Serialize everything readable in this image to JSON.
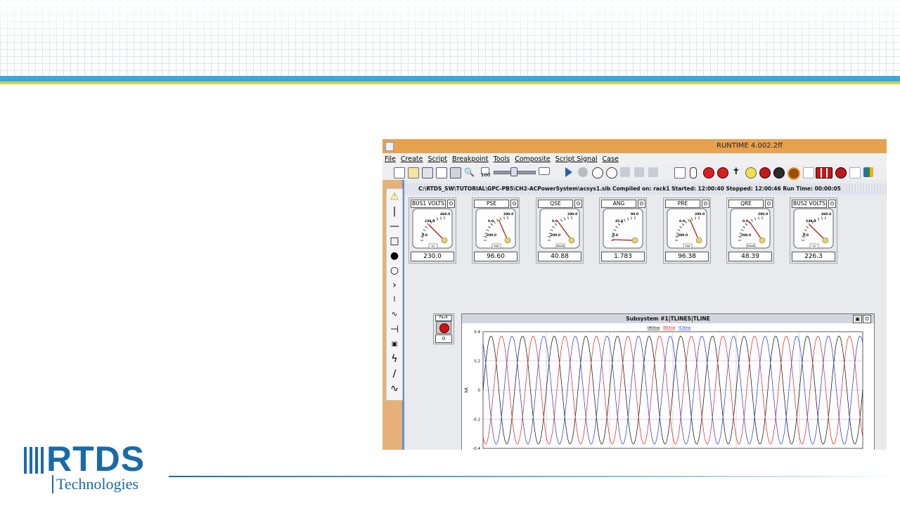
{
  "app": {
    "window_title": "RUNTIME 4.002.2ff",
    "menu": [
      "File",
      "Create",
      "Script",
      "Breakpoint",
      "Tools",
      "Composite",
      "Script Signal",
      "Case"
    ],
    "zoom_value": "100",
    "path_info": "C:\\RTDS_SW\\TUTORIAL\\GPC-PB5\\CH2-ACPowerSystem\\acsys1.sib   Compiled on: rack1   Started: 12:00:40  Stopped: 12:00:46  Run Time: 00:00:05"
  },
  "meters": [
    {
      "label": "BUS1 VOLTS",
      "unit": "kV",
      "scale": [
        "0.0",
        "230.0",
        "460.0"
      ],
      "value": "230.0",
      "frac": 0.5
    },
    {
      "label": "PSE",
      "unit": "MW",
      "scale": [
        "-200.0",
        "0.0",
        "200.0"
      ],
      "value": "96.60",
      "frac": 0.74
    },
    {
      "label": "QSE",
      "unit": "MVAR",
      "scale": [
        "-200.0",
        "0.0",
        "200.0"
      ],
      "value": "40.88",
      "frac": 0.6
    },
    {
      "label": "ANG",
      "unit": "",
      "scale": [
        "0.0",
        "45.0",
        "90.0"
      ],
      "value": "1.783",
      "frac": 0.02
    },
    {
      "label": "PRE",
      "unit": "MW",
      "scale": [
        "-200.0",
        "0.0",
        "200.0"
      ],
      "value": "96.38",
      "frac": 0.74
    },
    {
      "label": "QRE",
      "unit": "MVAR",
      "scale": [
        "-200.0",
        "0.0",
        "200.0"
      ],
      "value": "48.39",
      "frac": 0.62
    },
    {
      "label": "BUS2 VOLTS",
      "unit": "kV",
      "scale": [
        "0.0",
        "230.0",
        "460.0"
      ],
      "value": "226.3",
      "frac": 0.49
    }
  ],
  "fault": {
    "label": "Fault",
    "value": "0"
  },
  "plot": {
    "title": "Subsystem #1|TLINES|TLINE",
    "legend": [
      "IAtline",
      "IBtline",
      "ICtline"
    ]
  },
  "chart_data": {
    "type": "line",
    "title": "Subsystem #1|TLINES|TLINE",
    "xlabel": "",
    "ylabel": "kA",
    "xlim": [
      0,
      0.2
    ],
    "ylim": [
      -0.4,
      0.4
    ],
    "xticks": [
      "0",
      "0.03333",
      "0.06667",
      "0.1",
      "0.13333",
      "0.16667",
      "0.2"
    ],
    "yticks": [
      "0.4",
      "0.2",
      "0",
      "-0.2",
      "-0.4"
    ],
    "frequency_hz": 60,
    "amplitude": 0.37,
    "series": [
      {
        "name": "IAtline",
        "color": "#000000",
        "phase_deg": 0
      },
      {
        "name": "IBtline",
        "color": "#e01818",
        "phase_deg": -120
      },
      {
        "name": "ICtline",
        "color": "#1a2fd4",
        "phase_deg": 120
      }
    ]
  },
  "brand": {
    "logo_main": "RTDS",
    "logo_sub": "Technologies",
    "blue": "#1b6aa8",
    "stripe_blue": "#3aa7dd",
    "stripe_yellow": "#d3d64a"
  },
  "palette_icons": [
    "warning-icon",
    "vertical-line-icon",
    "horizontal-line-icon",
    "square-icon",
    "filled-circle-icon",
    "circle-icon",
    "chevron-icon",
    "resistor-icon",
    "inductor-icon",
    "capacitor-icon",
    "source-icon",
    "lightning-icon",
    "diagonal-line-icon",
    "sine-icon"
  ]
}
